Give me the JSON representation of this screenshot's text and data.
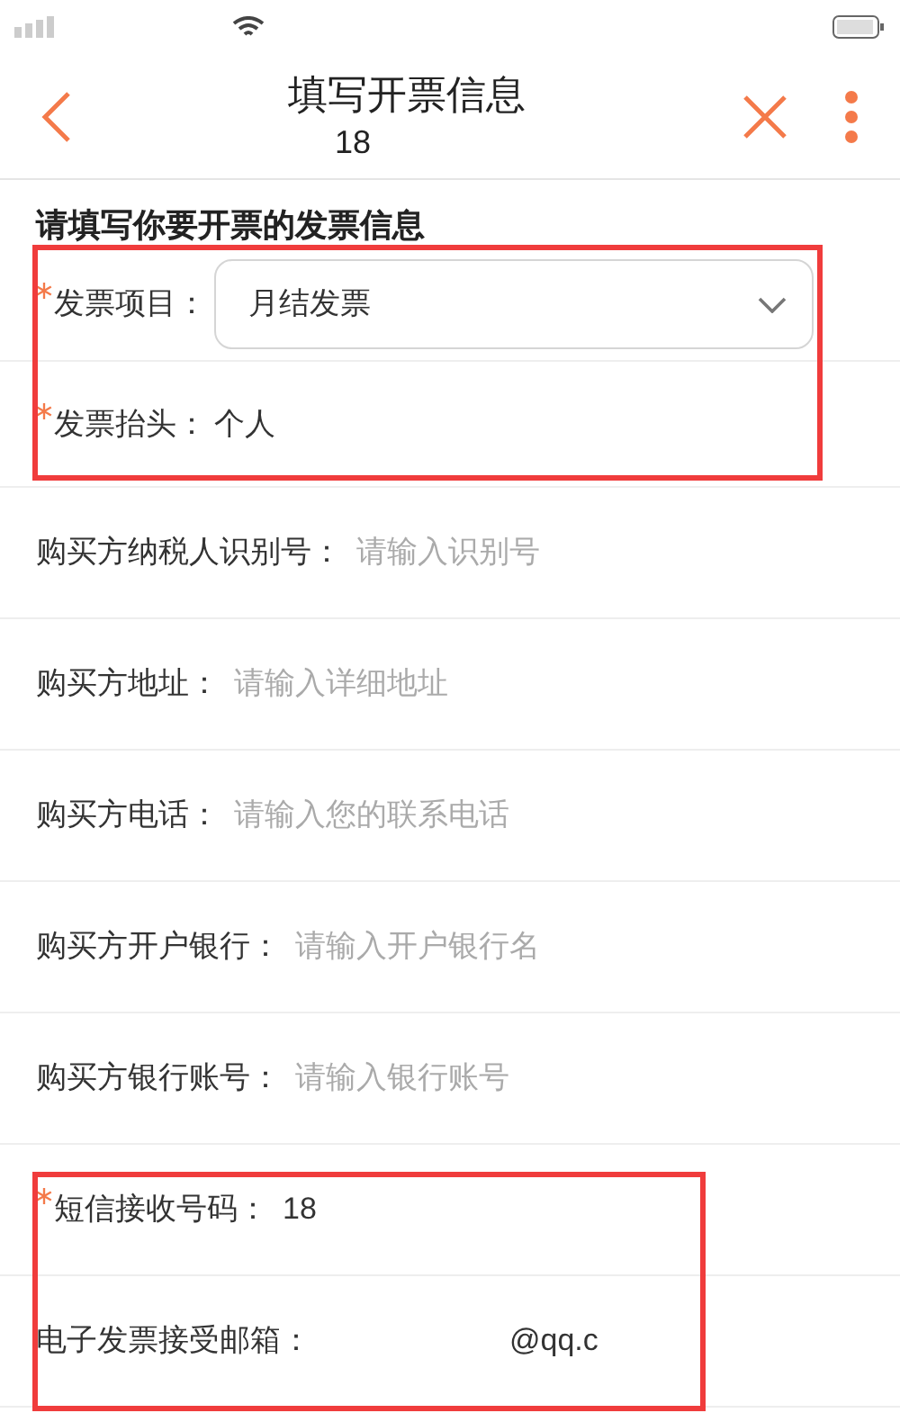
{
  "nav": {
    "title": "填写开票信息",
    "subtitle": "18"
  },
  "heading": "请填写你要开票的发票信息",
  "fields": [
    {
      "kind": "select",
      "label": "发票项目：",
      "required": true,
      "highlighted": true,
      "value": "月结发票"
    },
    {
      "kind": "static",
      "label": "发票抬头：",
      "required": true,
      "highlighted": true,
      "value": "个人"
    },
    {
      "kind": "input",
      "label": "购买方纳税人识别号：",
      "required": false,
      "highlighted": false,
      "placeholder": "请输入识别号"
    },
    {
      "kind": "input",
      "label": "购买方地址：",
      "required": false,
      "highlighted": false,
      "placeholder": "请输入详细地址"
    },
    {
      "kind": "input",
      "label": "购买方电话：",
      "required": false,
      "highlighted": false,
      "placeholder": "请输入您的联系电话"
    },
    {
      "kind": "input",
      "label": "购买方开户银行：",
      "required": false,
      "highlighted": false,
      "placeholder": "请输入开户银行名"
    },
    {
      "kind": "input",
      "label": "购买方银行账号：",
      "required": false,
      "highlighted": false,
      "placeholder": "请输入银行账号"
    },
    {
      "kind": "input",
      "label": "短信接收号码：",
      "required": true,
      "highlighted": true,
      "value": "18"
    },
    {
      "kind": "email",
      "label": "电子发票接受邮箱：",
      "required": false,
      "highlighted": true,
      "value": "@qq.c"
    }
  ]
}
